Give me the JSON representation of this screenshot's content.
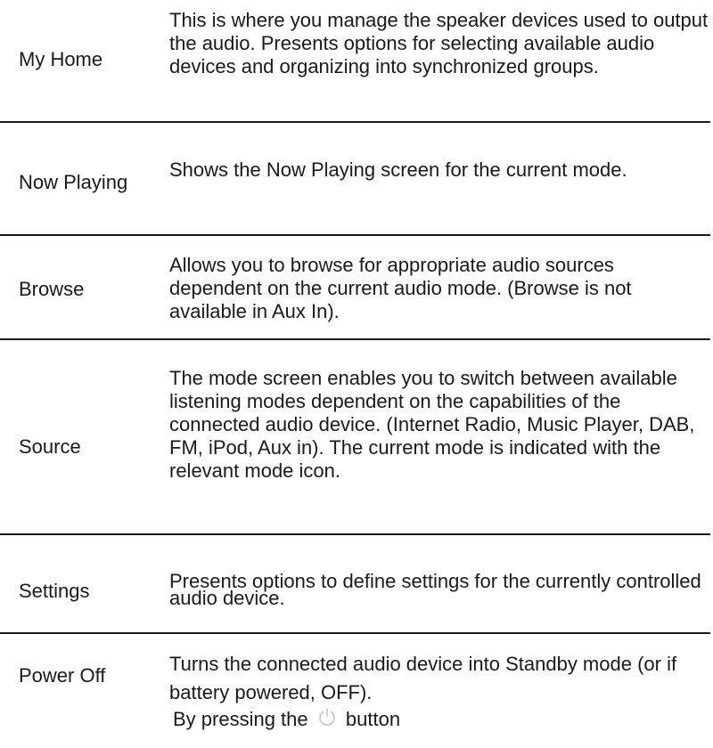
{
  "rows": [
    {
      "term": "My Home",
      "description": "This is where you manage the speaker devices used to output the audio. Presents options for selecting available audio devices and organizing into synchronized groups."
    },
    {
      "term": "Now Playing",
      "description": "Shows the Now Playing screen for the current mode."
    },
    {
      "term": "Browse",
      "description": "Allows you to browse for appropriate audio sources dependent on the current audio mode. (Browse is not available in Aux In)."
    },
    {
      "term": "Source",
      "description": "The mode screen enables you to switch between available listening modes dependent on the capabilities of the connected audio device. (Internet Radio, Music Player, DAB, FM, iPod, Aux in). The current mode is indicated with the relevant mode icon."
    },
    {
      "term": "Settings",
      "description": "Presents options to define settings for the currently controlled audio device."
    },
    {
      "term": "Power Off",
      "description": "Turns the connected audio device into Standby mode (or if battery powered, OFF).",
      "note_prefix": "By pressing the",
      "note_suffix": "button",
      "note_icon": "power-icon"
    }
  ]
}
